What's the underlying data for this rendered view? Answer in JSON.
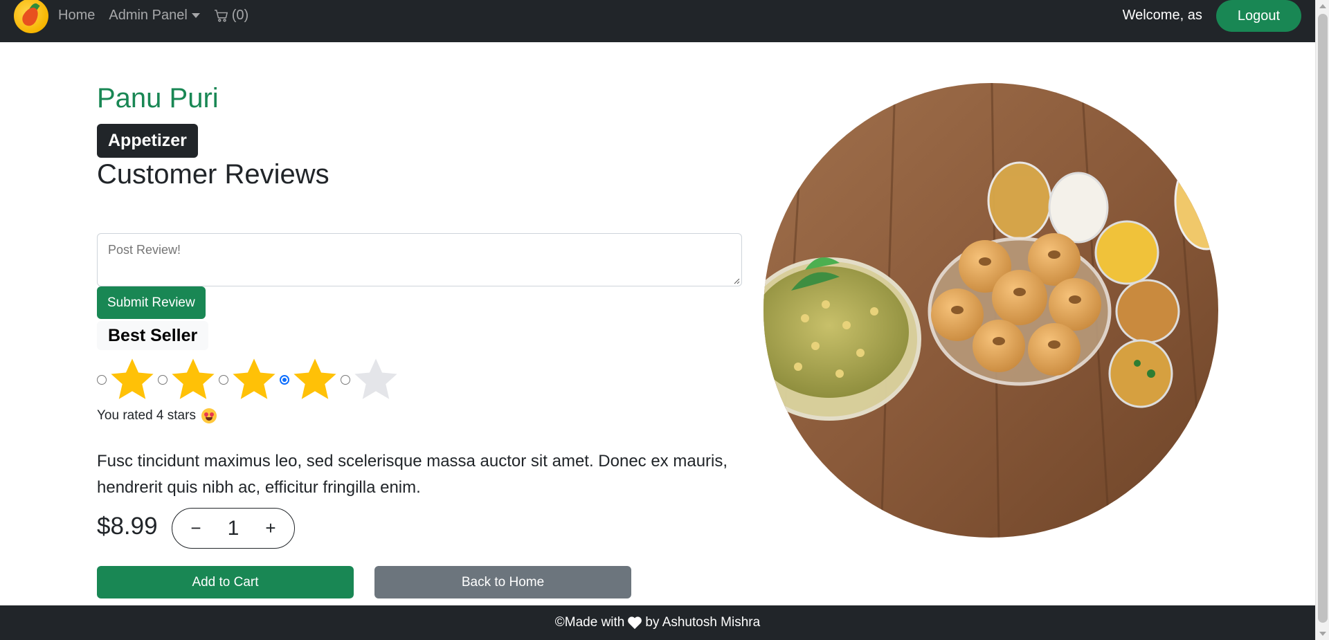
{
  "navbar": {
    "home_label": "Home",
    "admin_label": "Admin Panel",
    "cart_label": "(0)",
    "welcome_text": "Welcome, as",
    "logout_label": "Logout"
  },
  "product": {
    "name": "Panu Puri",
    "category": "Appetizer",
    "reviews_heading": "Customer Reviews",
    "review_placeholder": "Post Review!",
    "submit_label": "Submit Review",
    "badge": "Best Seller",
    "rating": 4,
    "rating_max": 5,
    "rated_text": "You rated 4 stars",
    "description": "Fusc tincidunt maximus leo, sed scelerisque massa auctor sit amet. Donec ex mauris, hendrerit quis nibh ac, efficitur fringilla enim.",
    "price": "$8.99",
    "quantity": "1",
    "minus_label": "−",
    "plus_label": "+",
    "add_to_cart_label": "Add to Cart",
    "back_label": "Back to Home"
  },
  "footer": {
    "prefix": "©Made with",
    "suffix": "by Ashutosh Mishra"
  },
  "colors": {
    "navbar_bg": "#212529",
    "success": "#198754",
    "secondary": "#6c757d",
    "star_filled": "#ffc107",
    "star_empty": "#e4e5e9"
  },
  "icons": [
    "brand-logo-icon",
    "chevron-down-icon",
    "cart-icon",
    "star-icon",
    "heart-icon",
    "heart-eyes-emoji-icon"
  ]
}
